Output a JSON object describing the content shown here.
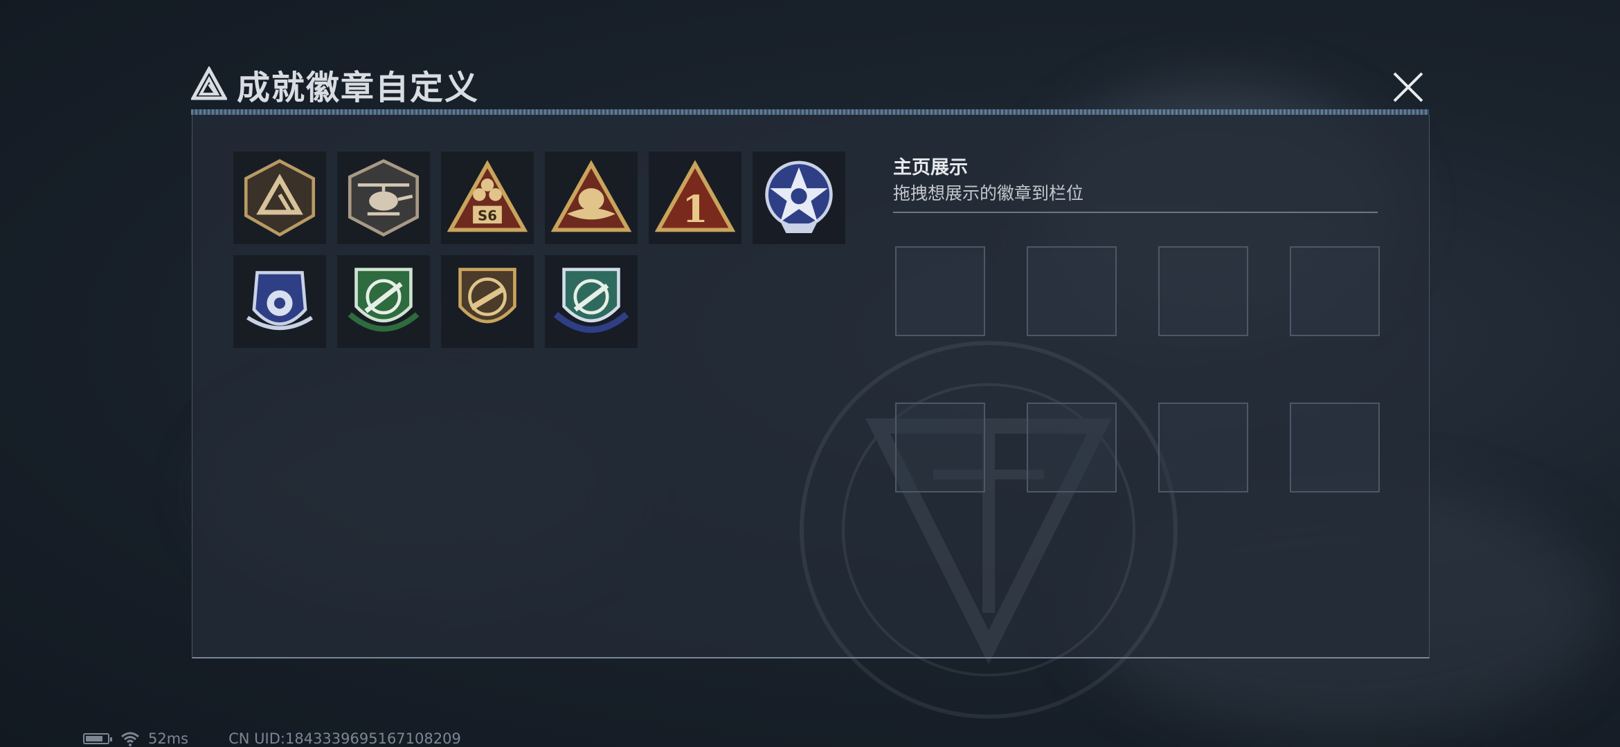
{
  "window": {
    "title": "成就徽章自定义"
  },
  "showcase": {
    "title": "主页展示",
    "subtitle": "拖拽想展示的徽章到栏位",
    "slot_count": 8
  },
  "badges": [
    {
      "name": "delta-triangle-shield-badge",
      "label": ""
    },
    {
      "name": "helicopter-shield-badge",
      "label": ""
    },
    {
      "name": "s6-triangle-badge",
      "label": "S6"
    },
    {
      "name": "bird-triangle-badge",
      "label": ""
    },
    {
      "name": "number-one-triangle-badge",
      "label": "1"
    },
    {
      "name": "skull-star-badge",
      "label": ""
    },
    {
      "name": "blue-winged-shield-badge",
      "label": ""
    },
    {
      "name": "green-rifle-crosshair-badge",
      "label": ""
    },
    {
      "name": "gold-smg-crosshair-badge",
      "label": ""
    },
    {
      "name": "blue-knife-crosshair-badge",
      "label": ""
    }
  ],
  "statusbar": {
    "battery_level": 0.8,
    "ping": "52ms",
    "uid": "CN UID:1843339695167108209"
  },
  "colors": {
    "panel_bg": "#242c37",
    "slot_border": "#4d5866",
    "gold": "#c9a45c",
    "dark_red": "#7a2a1c",
    "badge_blue": "#2f3f86",
    "badge_green": "#2e6b3e"
  }
}
